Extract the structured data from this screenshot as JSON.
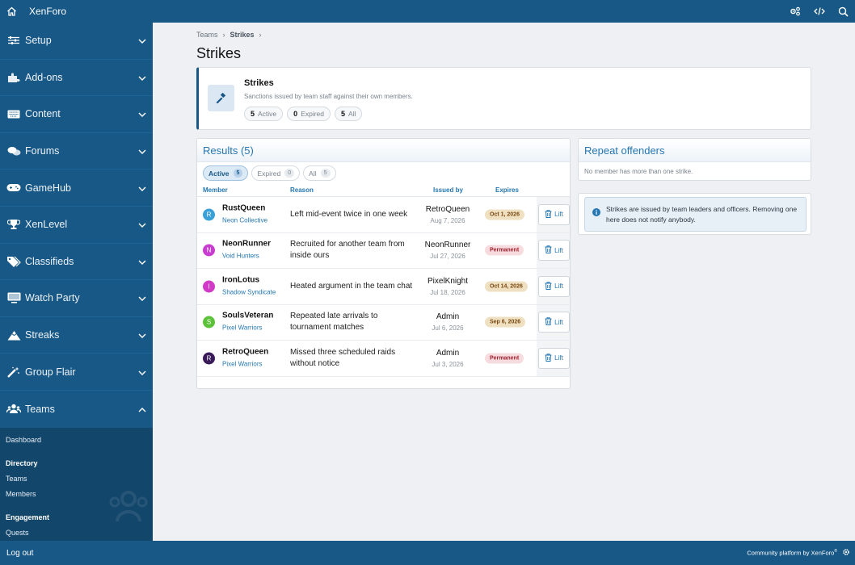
{
  "app": {
    "brand": "XenForo"
  },
  "sidebar": {
    "sections": [
      {
        "label": "Setup",
        "icon": "sliders-icon"
      },
      {
        "label": "Add-ons",
        "icon": "puzzle-icon"
      },
      {
        "label": "Content",
        "icon": "keyboard-icon"
      },
      {
        "label": "Forums",
        "icon": "comments-icon"
      },
      {
        "label": "GameHub",
        "icon": "gamepad-icon"
      },
      {
        "label": "XenLevel",
        "icon": "trophy-icon"
      },
      {
        "label": "Classifieds",
        "icon": "tags-icon"
      },
      {
        "label": "Watch Party",
        "icon": "monitor-icon"
      },
      {
        "label": "Streaks",
        "icon": "mountain-icon"
      },
      {
        "label": "Group Flair",
        "icon": "magic-wand-icon"
      }
    ],
    "open_section": {
      "label": "Teams",
      "icon": "users-icon"
    },
    "subnav": {
      "dashboard": "Dashboard",
      "group1": "Directory",
      "group1_items": [
        "Teams",
        "Members"
      ],
      "group2": "Engagement",
      "group2_items": [
        "Quests"
      ]
    }
  },
  "footer": {
    "logout": "Log out",
    "credit": "Community platform by XenForo",
    "credit_mark": "®"
  },
  "breadcrumb": [
    "Teams",
    "Strikes"
  ],
  "page": {
    "title": "Strikes"
  },
  "header": {
    "title": "Strikes",
    "description": "Sanctions issued by team staff against their own members.",
    "stats": [
      {
        "count": "5",
        "label": "Active"
      },
      {
        "count": "0",
        "label": "Expired"
      },
      {
        "count": "5",
        "label": "All"
      }
    ]
  },
  "results": {
    "title": "Results (5)",
    "tabs": [
      {
        "label": "Active",
        "count": "5"
      },
      {
        "label": "Expired",
        "count": "0"
      },
      {
        "label": "All",
        "count": "5"
      }
    ],
    "columns": [
      "Member",
      "Reason",
      "Issued by",
      "Expires"
    ],
    "lift_label": "Lift",
    "rows": [
      {
        "initial": "R",
        "color": "#3aa0d8",
        "user": "RustQueen",
        "team": "Neon Collective",
        "reason": "Left mid-event twice in one week",
        "issuer": "RetroQueen",
        "date": "Aug 7, 2026",
        "expires": "Oct 1, 2026",
        "kind": "date"
      },
      {
        "initial": "N",
        "color": "#c83dd0",
        "user": "NeonRunner",
        "team": "Void Hunters",
        "reason": "Recruited for another team from inside ours",
        "issuer": "NeonRunner",
        "date": "Jul 27, 2026",
        "expires": "Permanent",
        "kind": "perm"
      },
      {
        "initial": "I",
        "color": "#d23ac8",
        "user": "IronLotus",
        "team": "Shadow Syndicate",
        "reason": "Heated argument in the team chat",
        "issuer": "PixelKnight",
        "date": "Jul 18, 2026",
        "expires": "Oct 14, 2026",
        "kind": "date"
      },
      {
        "initial": "S",
        "color": "#5cc23a",
        "user": "SoulsVeteran",
        "team": "Pixel Warriors",
        "reason": "Repeated late arrivals to tournament matches",
        "issuer": "Admin",
        "date": "Jul 6, 2026",
        "expires": "Sep 6, 2026",
        "kind": "date"
      },
      {
        "initial": "R",
        "color": "#3a1b5a",
        "user": "RetroQueen",
        "team": "Pixel Warriors",
        "reason": "Missed three scheduled raids without notice",
        "issuer": "Admin",
        "date": "Jul 3, 2026",
        "expires": "Permanent",
        "kind": "perm"
      }
    ]
  },
  "repeat": {
    "title": "Repeat offenders",
    "note": "No member has more than one strike."
  },
  "info": {
    "text": "Strikes are issued by team leaders and officers. Removing one here does not notify anybody."
  },
  "colors": {
    "brand": "#185886",
    "accent": "#2577b1",
    "date_badge": "#efe0c2",
    "perm_badge": "#f7dcdf"
  }
}
